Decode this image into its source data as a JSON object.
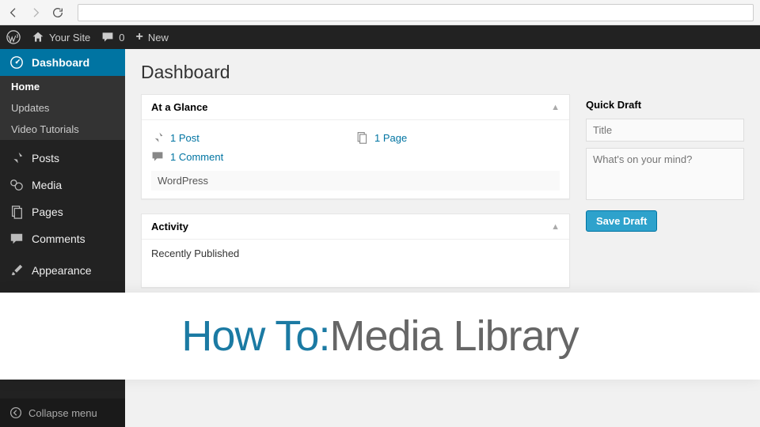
{
  "admin_bar": {
    "site_name": "Your Site",
    "comment_count": "0",
    "new_label": "New"
  },
  "sidebar": {
    "dashboard": "Dashboard",
    "submenu": {
      "home": "Home",
      "updates": "Updates",
      "tutorials": "Video Tutorials"
    },
    "posts": "Posts",
    "media": "Media",
    "pages": "Pages",
    "comments": "Comments",
    "appearance": "Appearance",
    "collapse": "Collapse menu"
  },
  "page": {
    "title": "Dashboard"
  },
  "glance": {
    "title": "At a Glance",
    "posts": "1 Post",
    "pages": "1 Page",
    "comments": "1 Comment",
    "version": "WordPress"
  },
  "activity": {
    "title": "Activity",
    "recent_label": "Recently Published"
  },
  "quickdraft": {
    "title": "Quick Draft",
    "title_placeholder": "Title",
    "content_placeholder": "What's on your mind?",
    "save_label": "Save Draft"
  },
  "banner": {
    "prefix": "How To:",
    "suffix": " Media Library"
  }
}
